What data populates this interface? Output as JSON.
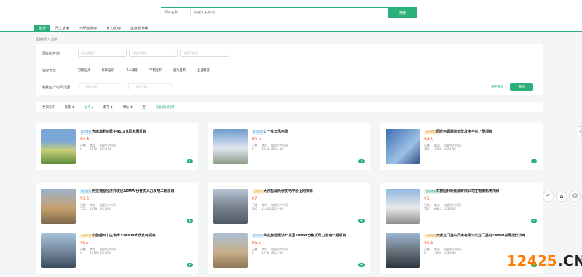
{
  "search": {
    "type_label": "项目名称",
    "placeholder": "请输入关键词",
    "button": "搜索"
  },
  "tabs": [
    "全部",
    "风力发电",
    "太阳能发电",
    "水力发电",
    "生物质发电"
  ],
  "breadcrumb": "全部结果 > 全部",
  "filters": {
    "project_location_label": "项目所在地",
    "location_dd": [
      "请选择省份",
      "请选择城市",
      "请选择区县"
    ],
    "quick_label": "快捷查找",
    "quick": [
      "近期挂牌",
      "新鲜出炉",
      "个人最爱",
      "不错推荐",
      "超大面积",
      "企业最爱"
    ],
    "date_label": "电量生产时间范围",
    "date_start": "开始日期",
    "date_end": "结束日期",
    "reset": "清空筛选",
    "submit": "筛选"
  },
  "sortbar": {
    "label": "更多排序",
    "items": [
      "销量 ⇕",
      "价格 ▴",
      "库存 ⇕",
      "单价 ⇕",
      "至"
    ],
    "default": "恢复默认排序"
  },
  "cards": [
    {
      "badge": "风力发电",
      "title": "大唐阜新彰武子45.5瓦风电场项目",
      "price": "¥5.6",
      "stock": "库存",
      "stockv": "2572",
      "date": "2024-06",
      "sold": "已售",
      "soldv": "0"
    },
    {
      "badge": "风力发电",
      "title": "辽宁东大风电场",
      "price": "¥6.5",
      "stock": "库存",
      "stockv": "2344",
      "date": "2024-06",
      "sold": "已售",
      "soldv": "0"
    },
    {
      "badge": "太阳能发电",
      "title": "阳光电源屋面光伏发电平价上网项目",
      "price": "¥4.9",
      "stock": "库存",
      "stockv": "3988",
      "date": "2024-06",
      "sold": "已售",
      "soldv": "355"
    },
    {
      "badge": "风力发电",
      "title": "阿拉善盟经济开发区10MW分散式风力发电二期项目",
      "price": "¥6.5",
      "stock": "库存",
      "stockv": "1939",
      "date": "2024-06",
      "sold": "已售",
      "soldv": "155"
    },
    {
      "badge": "太阳能发电",
      "title": "大庆盐硫光伏发电平价上网项目",
      "price": "¥7",
      "stock": "库存",
      "stockv": "11428",
      "date": "2024-06",
      "sold": "已售",
      "soldv": "100"
    },
    {
      "badge": "生物质发电",
      "title": "东营国利新能源有限公司生物质热电项目",
      "price": "¥5",
      "stock": "库存",
      "stockv": "6811",
      "date": "2024-06",
      "sold": "已售",
      "soldv": "712"
    },
    {
      "badge": "太阳能发电",
      "title": "华能盛州丁庄水库200MW光伏发电项目",
      "price": "¥15",
      "stock": "库存",
      "stockv": "23760",
      "date": "2024-06",
      "sold": "已售",
      "soldv": "0"
    },
    {
      "badge": "风力发电",
      "title": "阿拉善盟经济开发区10MW分散式风力发电一期项目",
      "price": "¥6.5",
      "stock": "库存",
      "stockv": "1976",
      "date": "2024-06",
      "sold": "已售",
      "soldv": "0"
    },
    {
      "badge": "太阳能发电",
      "title": "大唐玉门昌马风电有限公司玉门昌马50MW并网光伏发电...",
      "price": "¥5.5",
      "stock": "库存",
      "stockv": "7860",
      "date": "2024-06",
      "sold": "已售",
      "soldv": "0"
    }
  ],
  "stat_date_label": "电量生产时间",
  "watermark": {
    "a": "12425",
    "b": ".CN"
  },
  "colors": {
    "accent": "#2bb07a",
    "price": "#ff5b2b"
  }
}
